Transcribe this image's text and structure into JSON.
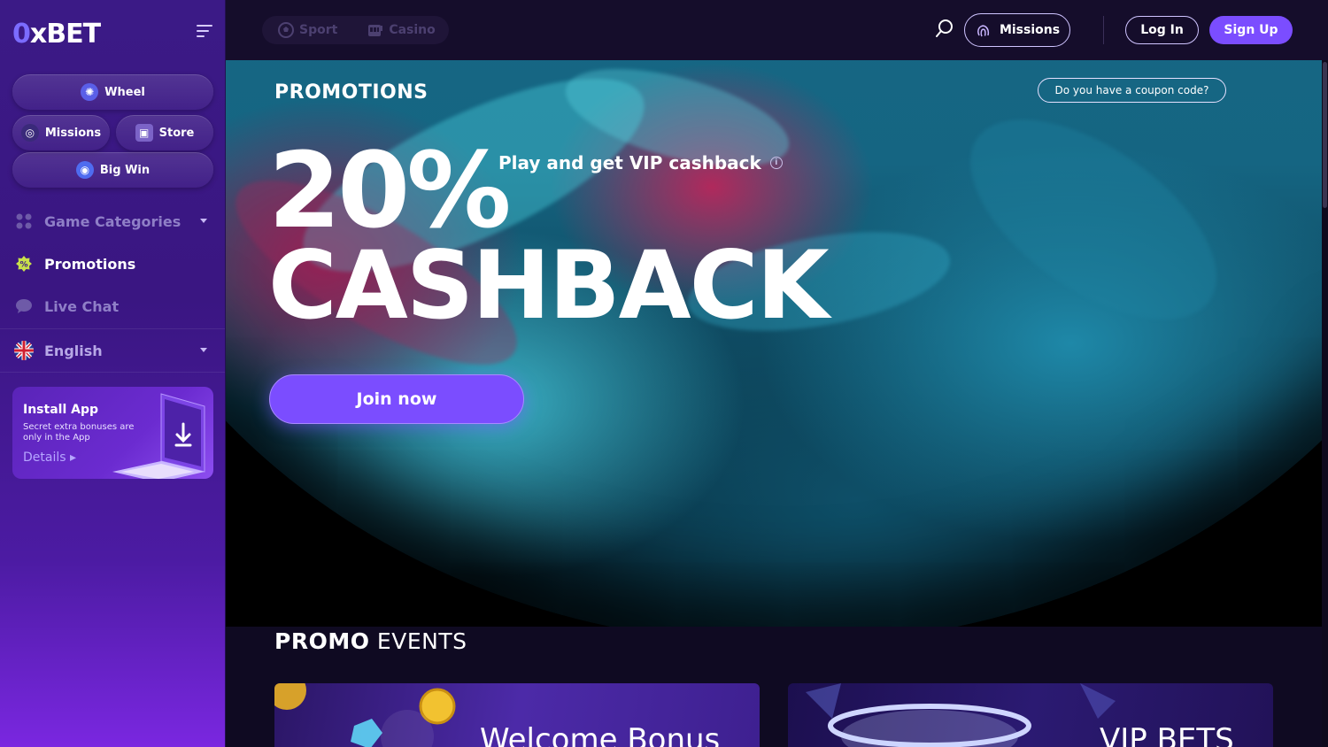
{
  "brand": {
    "logo_prefix": "0",
    "logo_text": "xBET",
    "accent": "#7b4dff"
  },
  "sidebar": {
    "quick_links": {
      "wheel": "Wheel",
      "missions": "Missions",
      "store": "Store",
      "big_win": "Big Win"
    },
    "nav": {
      "game_categories": "Game Categories",
      "promotions": "Promotions",
      "live_chat": "Live Chat",
      "language": "English"
    },
    "install": {
      "title": "Install App",
      "subtitle": "Secret extra bonuses are only in the App",
      "details": "Details"
    }
  },
  "topbar": {
    "tabs": [
      "Sport",
      "Casino"
    ],
    "missions": "Missions",
    "login": "Log In",
    "signup": "Sign Up"
  },
  "hero": {
    "section_label": "PROMOTIONS",
    "coupon": "Do you have a coupon code?",
    "percent": "20%",
    "tagline": "Play and get VIP cashback",
    "headline": "CASHBACK",
    "cta": "Join now"
  },
  "promo_events": {
    "title_bold": "PROMO",
    "title_rest": "EVENTS",
    "cards": [
      "Welcome Bonus",
      "VIP BETS"
    ]
  }
}
